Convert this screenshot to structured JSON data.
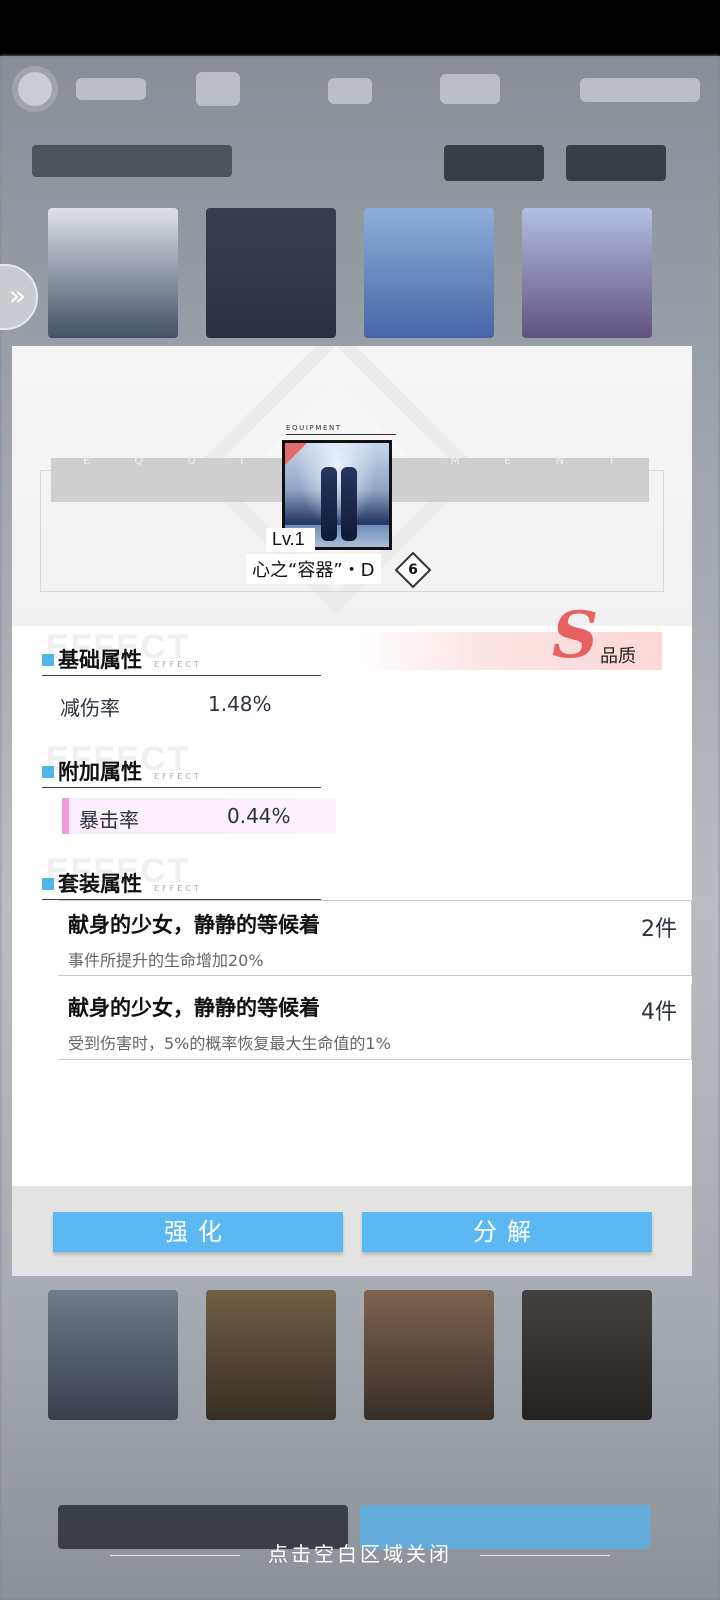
{
  "equipment": {
    "banner_letters": [
      "E",
      "Q",
      "U",
      "I",
      "P",
      "M",
      "E",
      "N",
      "T"
    ],
    "small_label": "EQUIPMENT",
    "level": "Lv.1",
    "name": "心之“容器”・D",
    "lock_icon": "lock-icon"
  },
  "quality": {
    "grade": "S",
    "label": "品质",
    "color": "#e86060"
  },
  "sections": {
    "base": {
      "ghost": "EFFECT",
      "title": "基础属性",
      "mini": "EFFECT"
    },
    "bonus": {
      "ghost": "EFFECT",
      "title": "附加属性",
      "mini": "EFFECT"
    },
    "set": {
      "ghost": "EFFECT",
      "title": "套装属性",
      "mini": "EFFECT"
    }
  },
  "base_stats": [
    {
      "name": "减伤率",
      "value": "1.48%"
    }
  ],
  "bonus_stats": [
    {
      "name": "暴击率",
      "value": "0.44%"
    }
  ],
  "set_bonuses": [
    {
      "name": "献身的少女，静静的等候着",
      "count": "2件",
      "desc": "事件所提升的生命增加20%"
    },
    {
      "name": "献身的少女，静静的等候着",
      "count": "4件",
      "desc": "受到伤害时，5%的概率恢复最大生命值的1%"
    }
  ],
  "actions": {
    "enhance": "强化",
    "dismantle": "分解"
  },
  "close_hint": "点击空白区域关闭",
  "colors": {
    "accent": "#5bb8f3",
    "section_marker": "#4fb6ea",
    "bonus_bar": "#f29bd8"
  }
}
